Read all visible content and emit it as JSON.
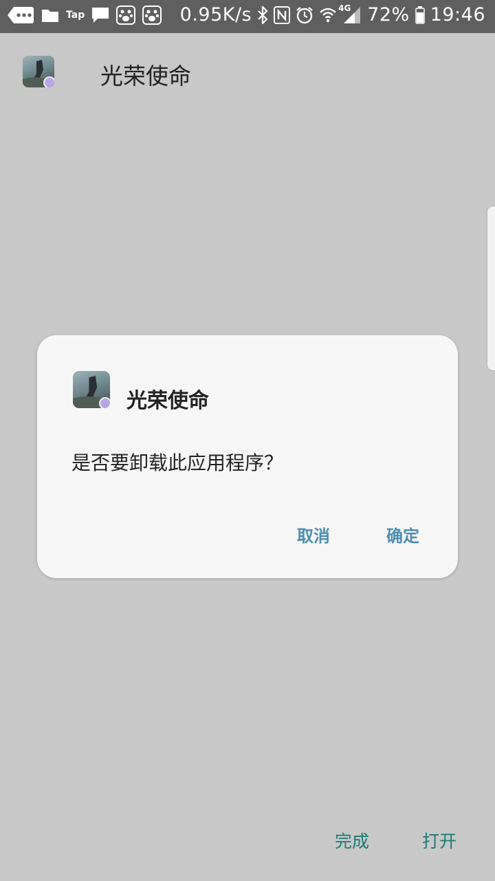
{
  "status_bar": {
    "net_speed": "0.95K/s",
    "network_type": "4G",
    "battery": "72%",
    "time": "19:46",
    "tap_label": "Tap",
    "icons": [
      "more-icon",
      "folder-icon",
      "taptap-icon",
      "message-icon",
      "baidu-icon",
      "baidu-icon-2",
      "bluetooth-icon",
      "nfc-icon",
      "alarm-icon",
      "wifi-icon",
      "signal-icon",
      "battery-icon"
    ]
  },
  "app": {
    "name": "光荣使命"
  },
  "dialog": {
    "title": "光荣使命",
    "message": "是否要卸载此应用程序？",
    "cancel_label": "取消",
    "confirm_label": "确定",
    "accent_color": "#4b8eb0"
  },
  "bottom": {
    "done_label": "完成",
    "open_label": "打开",
    "accent_color": "#1d7a74"
  }
}
